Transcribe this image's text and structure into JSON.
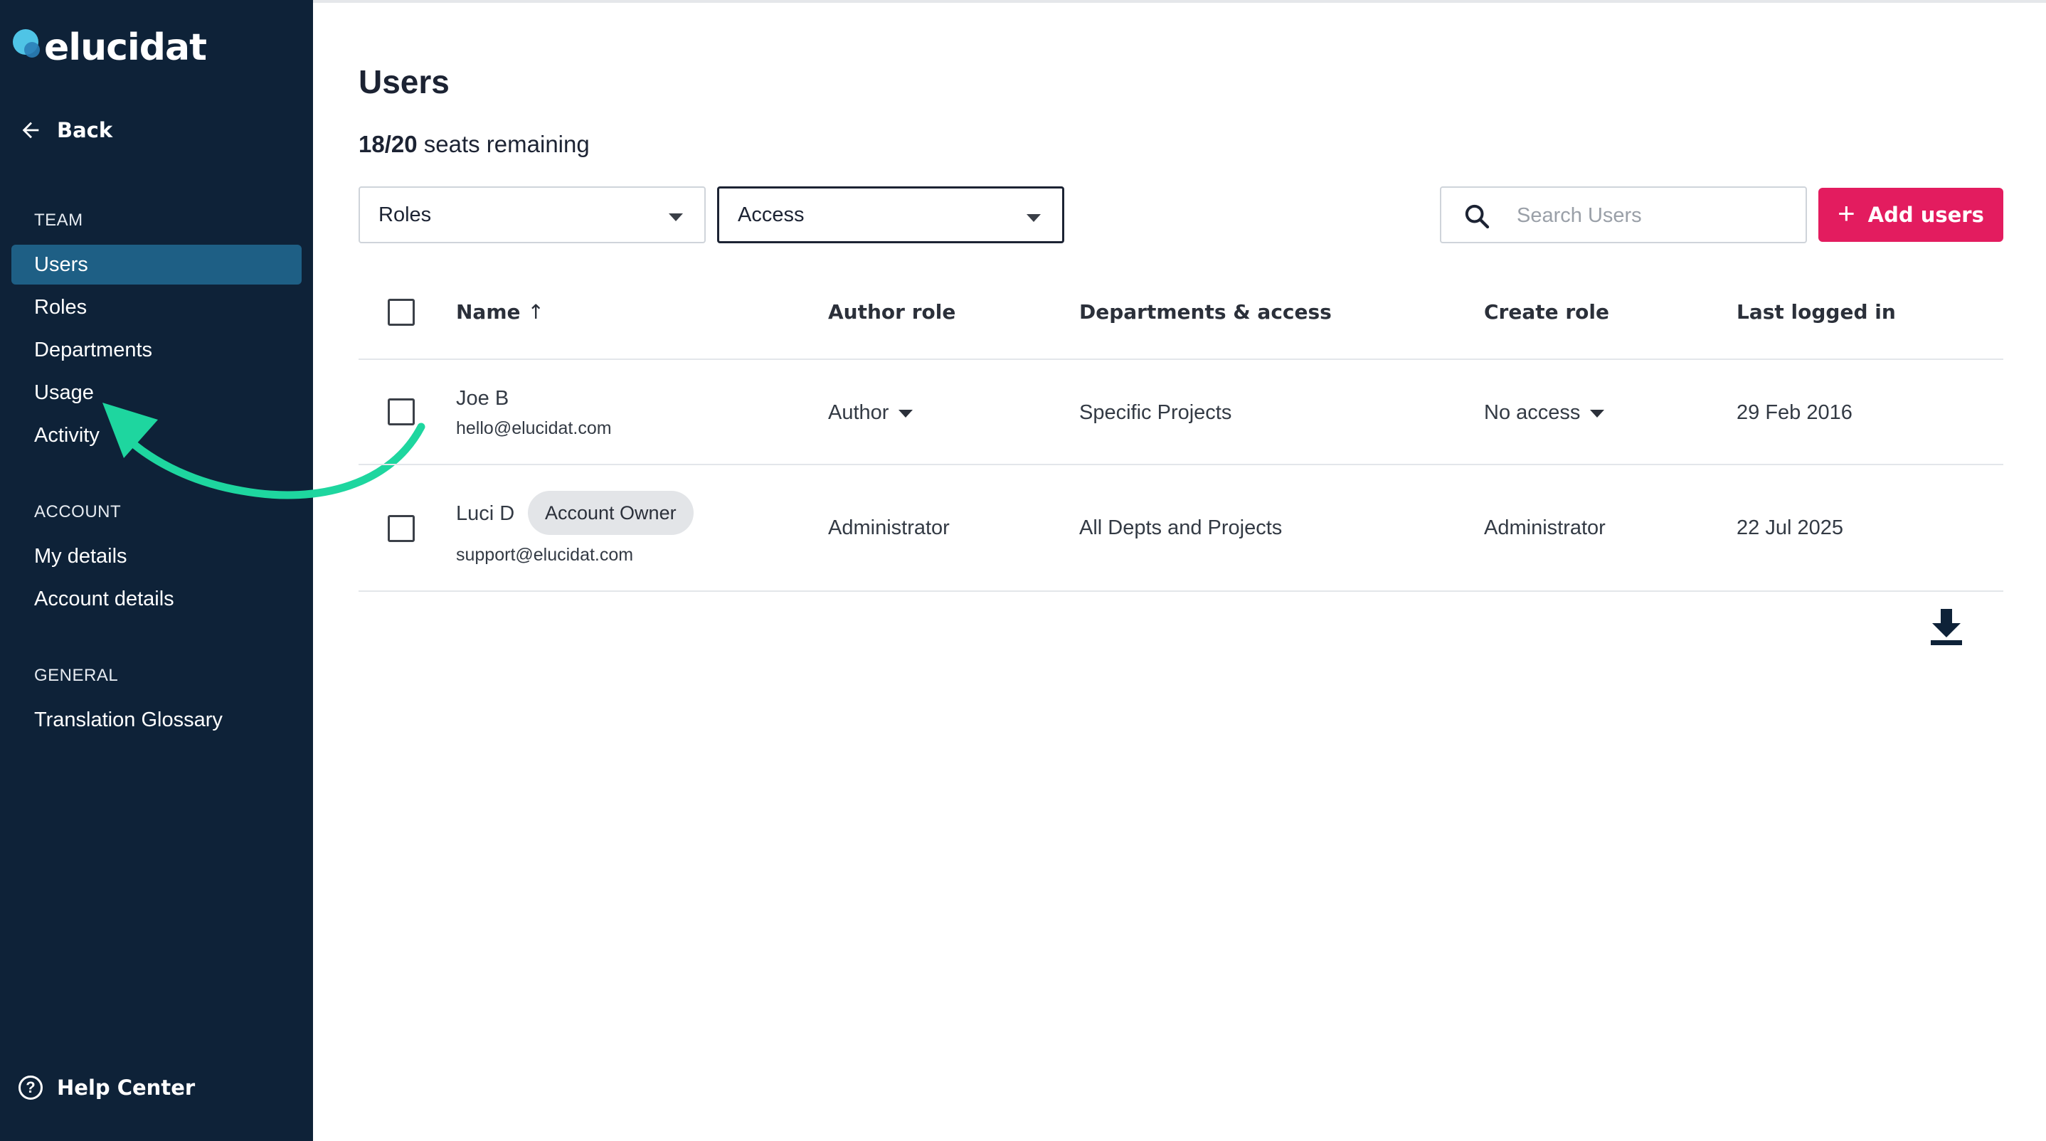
{
  "brand": {
    "name": "elucidat",
    "accent": "#e31c5f",
    "sidebar_bg": "#0e2238",
    "active_bg": "#1e5f85",
    "annotation_color": "#1ed69f"
  },
  "sidebar": {
    "back_label": "Back",
    "sections": [
      {
        "title": "TEAM",
        "items": [
          {
            "label": "Users",
            "active": true
          },
          {
            "label": "Roles"
          },
          {
            "label": "Departments"
          },
          {
            "label": "Usage"
          },
          {
            "label": "Activity"
          }
        ]
      },
      {
        "title": "ACCOUNT",
        "items": [
          {
            "label": "My details"
          },
          {
            "label": "Account details"
          }
        ]
      },
      {
        "title": "GENERAL",
        "items": [
          {
            "label": "Translation Glossary"
          }
        ]
      }
    ],
    "help_label": "Help Center"
  },
  "main": {
    "title": "Users",
    "seats_count": "18/20",
    "seats_text": " seats remaining",
    "filters": [
      {
        "label": "Roles"
      },
      {
        "label": "Access"
      }
    ],
    "search": {
      "placeholder": "Search Users",
      "value": ""
    },
    "add_button_label": "Add users",
    "table": {
      "headers": [
        "Name",
        "Author role",
        "Departments & access",
        "Create role",
        "Last logged in"
      ],
      "rows": [
        {
          "name": "Joe B",
          "email": "hello@elucidat.com",
          "author_role": "Author",
          "departments": "Specific Projects",
          "create_role": "No access",
          "last_logged_in": "29 Feb 2016"
        },
        {
          "name": "Luci D",
          "badge": "Account Owner",
          "email": "support@elucidat.com",
          "author_role": "Administrator",
          "departments": "All Depts and Projects",
          "create_role": "Administrator",
          "last_logged_in": "22 Jul 2025"
        }
      ]
    }
  }
}
